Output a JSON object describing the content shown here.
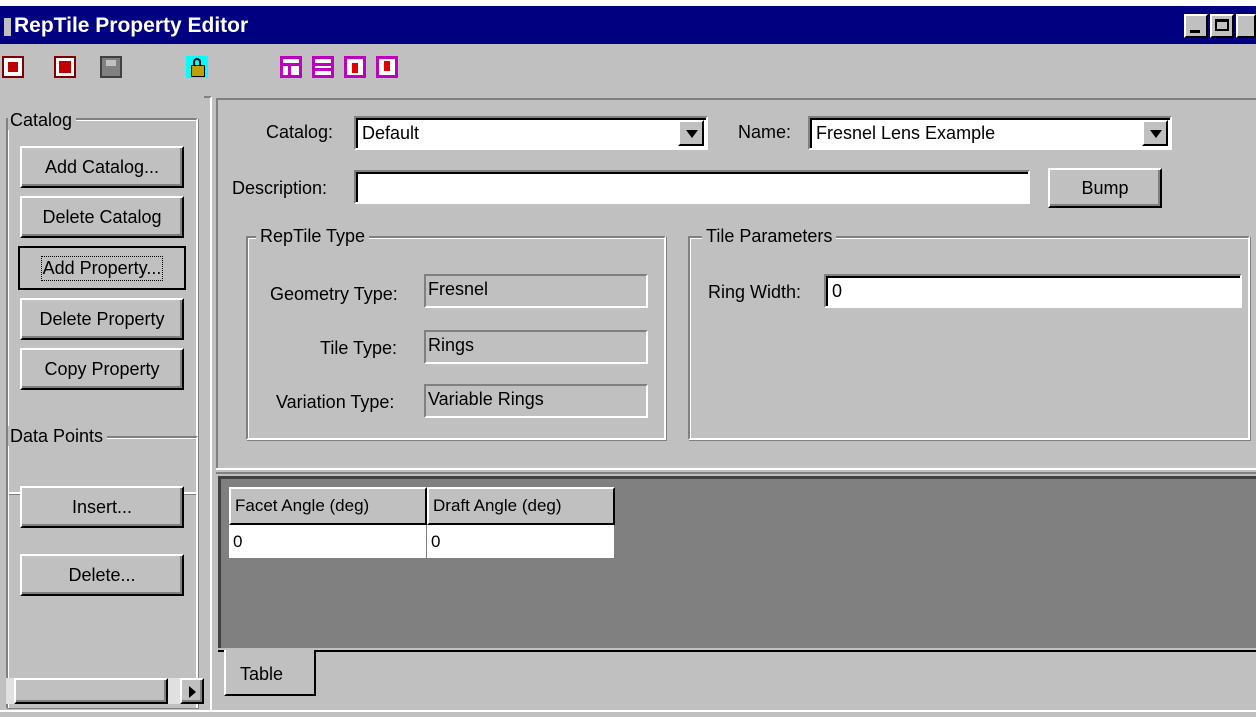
{
  "window": {
    "title": "RepTile Property Editor"
  },
  "toolbar": {
    "icons": [
      "export-icon",
      "import-icon",
      "save-icon",
      "unlock-icon",
      "layout-left-icon",
      "layout-split-icon",
      "insert-below-icon",
      "insert-above-icon"
    ]
  },
  "sidebar": {
    "catalog_group_label": "Catalog",
    "add_catalog": "Add Catalog...",
    "delete_catalog": "Delete Catalog",
    "add_property": "Add Property...",
    "delete_property": "Delete Property",
    "copy_property": "Copy Property",
    "data_points_group_label": "Data Points",
    "insert": "Insert...",
    "delete": "Delete..."
  },
  "form": {
    "catalog_label": "Catalog:",
    "catalog_value": "Default",
    "name_label": "Name:",
    "name_value": "Fresnel Lens Example",
    "description_label": "Description:",
    "description_value": "",
    "bump_button": "Bump"
  },
  "reptile_type": {
    "group_label": "RepTile Type",
    "geometry_label": "Geometry Type:",
    "geometry_value": "Fresnel",
    "tile_label": "Tile Type:",
    "tile_value": "Rings",
    "variation_label": "Variation Type:",
    "variation_value": "Variable Rings"
  },
  "tile_parameters": {
    "group_label": "Tile Parameters",
    "ring_width_label": "Ring Width:",
    "ring_width_value": "0"
  },
  "table": {
    "columns": [
      "Facet Angle (deg)",
      "Draft Angle (deg)"
    ],
    "rows": [
      [
        "0",
        "0"
      ]
    ],
    "tab_label": "Table"
  }
}
